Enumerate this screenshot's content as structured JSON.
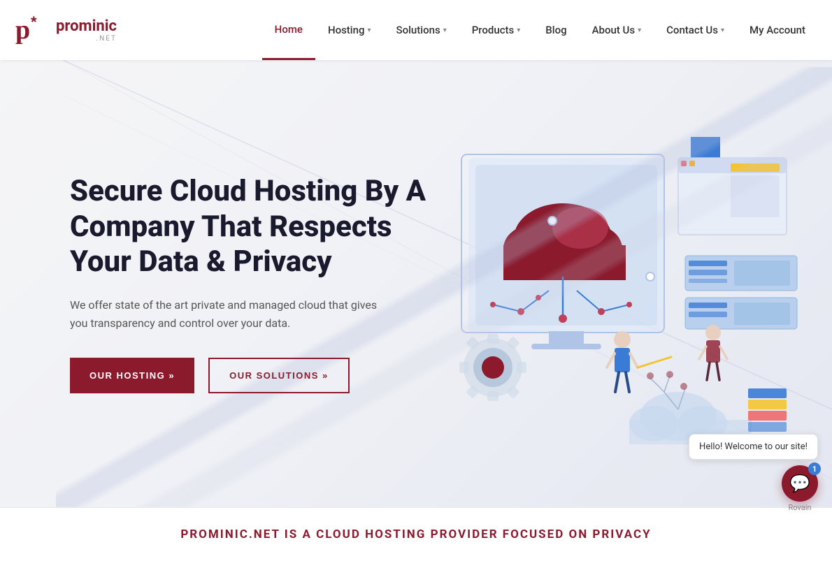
{
  "navbar": {
    "logo_text": "prominic",
    "logo_sub": ".NET",
    "links": [
      {
        "label": "Home",
        "active": true,
        "has_dropdown": false
      },
      {
        "label": "Hosting",
        "active": false,
        "has_dropdown": true
      },
      {
        "label": "Solutions",
        "active": false,
        "has_dropdown": true
      },
      {
        "label": "Products",
        "active": false,
        "has_dropdown": true
      },
      {
        "label": "Blog",
        "active": false,
        "has_dropdown": false
      },
      {
        "label": "About Us",
        "active": false,
        "has_dropdown": true
      },
      {
        "label": "Contact Us",
        "active": false,
        "has_dropdown": true
      },
      {
        "label": "My Account",
        "active": false,
        "has_dropdown": false
      }
    ]
  },
  "hero": {
    "title": "Secure Cloud Hosting By A Company That Respects Your Data & Privacy",
    "subtitle": "We offer state of the art private and managed cloud that gives you transparency and control over your data.",
    "btn_primary": "OUR HOSTING »",
    "btn_outline": "OUR SOLUTIONS »"
  },
  "footer_banner": {
    "text": "PROMINIC.NET IS A CLOUD HOSTING PROVIDER FOCUSED ON PRIVACY"
  },
  "chat": {
    "bubble_text": "Hello! Welcome to our site!",
    "badge_count": "1",
    "brand": "Rovain"
  },
  "icons": {
    "chevron": "▾",
    "chat": "💬",
    "asterisk": "*"
  },
  "colors": {
    "brand_red": "#8b1a2d",
    "accent_blue": "#3a7bd5"
  }
}
